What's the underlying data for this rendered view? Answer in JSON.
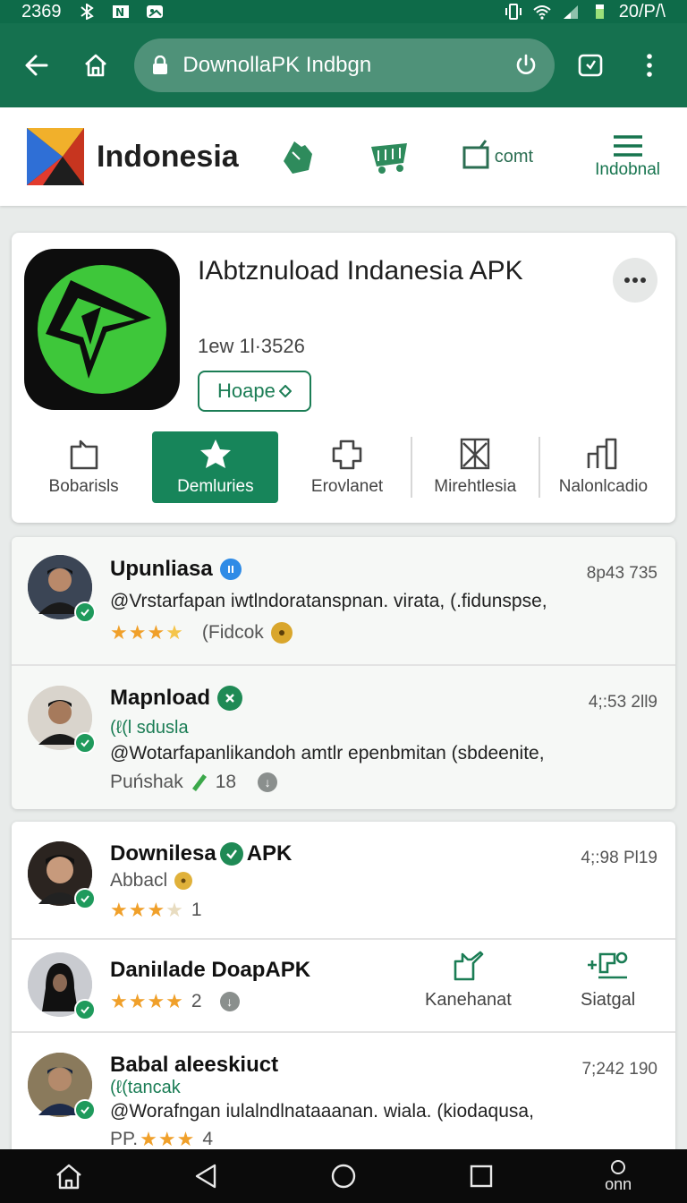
{
  "status_bar": {
    "time": "2369",
    "right_text": "20/P/\\",
    "bg": "#0e6b49"
  },
  "browser": {
    "url": "DownollaPK Indbgn",
    "back_icon": "back-arrow-icon",
    "home_icon": "home-icon",
    "reload_icon": "power-reload-icon",
    "tabs_icon": "tabs-icon",
    "menu_icon": "kebab-menu-icon",
    "toolbar_color": "#15714f"
  },
  "site_header": {
    "brand": "Indonesia",
    "nav_text_item": "comt",
    "menu_label": "Indobnal"
  },
  "app": {
    "title": "IAbtznuload Indanesia APK",
    "subtitle": "1ew 1l·3526",
    "tag": "Hoape",
    "accent": "#17855a",
    "actions": [
      {
        "label": "Bobarisls",
        "icon": "share-icon"
      },
      {
        "label": "Demluries",
        "icon": "star-icon",
        "active": true
      },
      {
        "label": "Erovlanet",
        "icon": "puzzle-icon"
      },
      {
        "label": "Mirehtlesia",
        "icon": "tools-icon"
      },
      {
        "label": "Nalonlcadio",
        "icon": "chart-icon"
      }
    ]
  },
  "list_top": [
    {
      "name": "Upunliasa",
      "time": "8p43 735",
      "desc": "@Vrstarfapan iwtlndoratanspnan. virata, (.fidunspse,",
      "meta": "(Fidcok",
      "rating": 4
    },
    {
      "name": "Mapnload",
      "time": "4;:53 2ll9",
      "sub": "(ℓ(l sdusla",
      "desc": "@Wotarfapanlikandoh amtlr epenbmitan (sbdeenite,",
      "meta": "Puńshak",
      "meta_count": "18"
    }
  ],
  "list_bottom": [
    {
      "name": "Downilesa",
      "name_suffix": "APK",
      "time": "4;:98 Pl19",
      "sub": "Abbacl",
      "rating": 3,
      "count": "1"
    },
    {
      "name": "Daniılade DoapAPK",
      "rating": 4,
      "count": "2",
      "action1": "Kanehanat",
      "action2": "Siatgal"
    },
    {
      "name": "Babal aleeskiuct",
      "time": "7;242 190",
      "sub": "(ℓ(tancak",
      "desc": "@Worafngan iulalndlnataaanan. wiala. (kiodaqusa,",
      "meta": "PP.",
      "rating": 3,
      "count": "4"
    }
  ],
  "nav": {
    "last_label": "onn"
  }
}
